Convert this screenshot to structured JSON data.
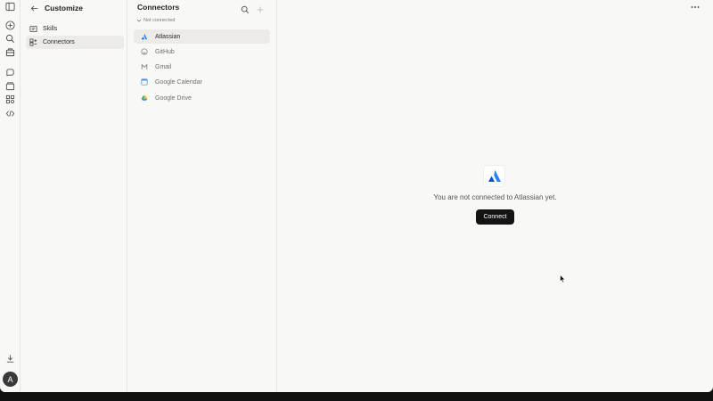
{
  "rail": {
    "avatar_initial": "A",
    "icons": [
      "sidebar-toggle-icon",
      "new-chat-icon",
      "search-icon",
      "customize-icon",
      "chats-icon",
      "projects-icon",
      "artifacts-icon",
      "code-icon",
      "download-icon"
    ]
  },
  "customize": {
    "title": "Customize",
    "items": [
      {
        "label": "Skills",
        "icon": "skills-icon"
      },
      {
        "label": "Connectors",
        "icon": "connectors-icon",
        "active": true
      }
    ]
  },
  "connectors": {
    "title": "Connectors",
    "section_label": "Not connected",
    "items": [
      {
        "label": "Atlassian",
        "icon": "atlassian-icon",
        "active": true
      },
      {
        "label": "GitHub",
        "icon": "github-icon"
      },
      {
        "label": "Gmail",
        "icon": "gmail-icon"
      },
      {
        "label": "Google Calendar",
        "icon": "google-calendar-icon"
      },
      {
        "label": "Google Drive",
        "icon": "google-drive-icon"
      }
    ]
  },
  "main": {
    "empty_message": "You are not connected to Atlassian yet.",
    "connect_label": "Connect"
  },
  "colors": {
    "background": "#f8f8f6",
    "active_item": "#ecebe7",
    "button": "#141414",
    "atlassian_blue": "#2684ff"
  }
}
